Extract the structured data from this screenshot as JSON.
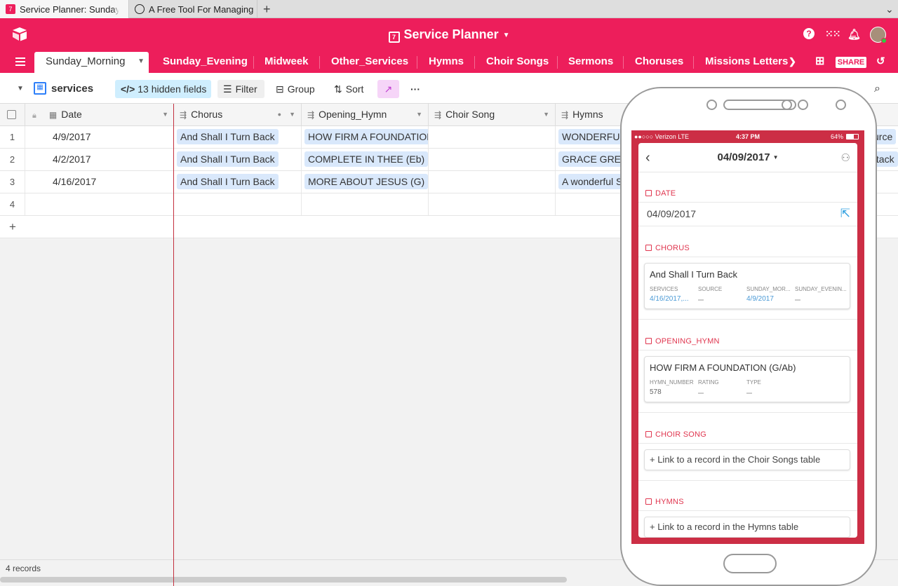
{
  "browser": {
    "tabs": [
      {
        "title": "Service Planner: Sunday_M"
      },
      {
        "title": "A Free Tool For Managing"
      }
    ],
    "new_tab": "+"
  },
  "app": {
    "base_title": "Service Planner",
    "accent_color": "#ed1e5b"
  },
  "tables": [
    "Sunday_Morning",
    "Sunday_Evening",
    "Midweek",
    "Other_Services",
    "Hymns",
    "Choir Songs",
    "Sermons",
    "Choruses",
    "Missions Letters"
  ],
  "share_label": "SHARE",
  "toolbar": {
    "view_name": "services",
    "hidden_fields": "13 hidden fields",
    "filter": "Filter",
    "group": "Group",
    "sort": "Sort"
  },
  "grid": {
    "columns": [
      "Date",
      "Chorus",
      "Opening_Hymn",
      "Choir Song",
      "Hymns"
    ],
    "rows": [
      {
        "num": "1",
        "date": "4/9/2017",
        "chorus": "And Shall I Turn Back",
        "opening": "HOW FIRM A FOUNDATION",
        "hymns": "WONDERFUL",
        "extra": "urce"
      },
      {
        "num": "2",
        "date": "4/2/2017",
        "chorus": "And Shall I Turn Back",
        "opening": "COMPLETE IN THEE (Eb)",
        "hymns": "GRACE GREA",
        "extra": "ttack"
      },
      {
        "num": "3",
        "date": "4/16/2017",
        "chorus": "And Shall I Turn Back",
        "opening": "MORE ABOUT JESUS (G)",
        "hymns": "A wonderful S",
        "extra": ""
      }
    ],
    "empty_row_num": "4",
    "add_row": "+",
    "record_count": "4 records"
  },
  "mobile": {
    "status": {
      "carrier": "●●○○○ Verizon  LTE",
      "time": "4:37 PM",
      "battery": "64%"
    },
    "record_title": "04/09/2017",
    "sections": {
      "date_label": "DATE",
      "date_value": "04/09/2017",
      "chorus_label": "CHORUS",
      "chorus_title": "And Shall I Turn Back",
      "chorus_fields": [
        "SERVICES",
        "SOURCE",
        "SUNDAY_MOR...",
        "SUNDAY_EVENIN..."
      ],
      "chorus_values": [
        "4/16/2017,...",
        "4/9/2017"
      ],
      "opening_label": "OPENING_HYMN",
      "opening_title": "HOW FIRM A FOUNDATION (G/Ab)",
      "opening_fields": [
        "HYMN_NUMBER",
        "RATING",
        "TYPE"
      ],
      "opening_values": [
        "578"
      ],
      "choir_label": "CHOIR SONG",
      "choir_link": "+ Link to a record in the Choir Songs table",
      "hymns_label": "HYMNS",
      "hymns_link": "+ Link to a record in the Hymns table"
    }
  }
}
